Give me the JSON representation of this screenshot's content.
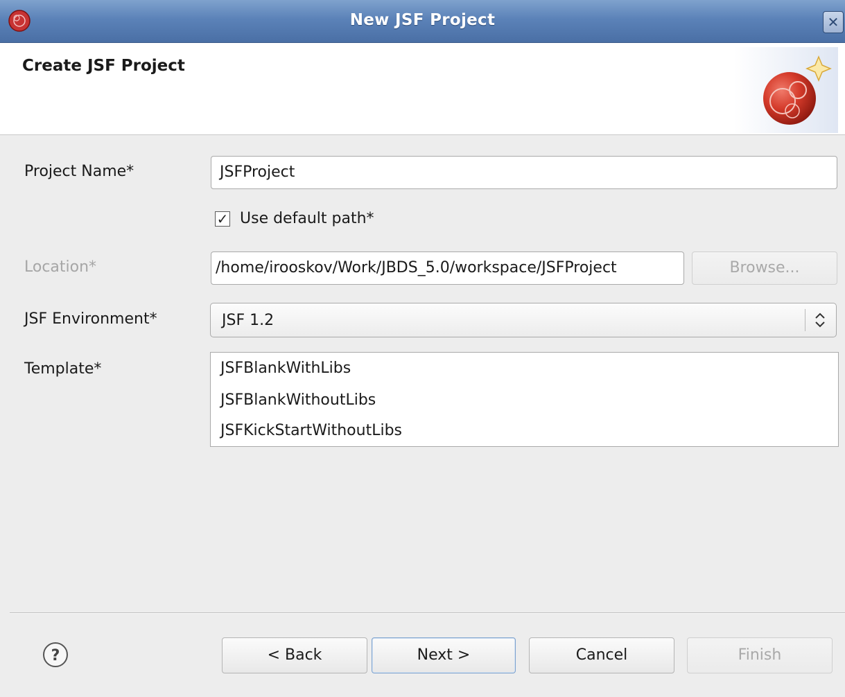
{
  "window": {
    "title": "New JSF Project",
    "close_glyph": "✕"
  },
  "header": {
    "title": "Create JSF Project",
    "banner_icon": "jsf-project-wizard-icon"
  },
  "form": {
    "project_name": {
      "label": "Project Name*",
      "value": "JSFProject"
    },
    "use_default_path": {
      "label": "Use default path*",
      "checked": true
    },
    "location": {
      "label": "Location*",
      "value": "/home/irooskov/Work/JBDS_5.0/workspace/JSFProject",
      "browse_label": "Browse..."
    },
    "jsf_environment": {
      "label": "JSF Environment*",
      "value": "JSF 1.2"
    },
    "template": {
      "label": "Template*",
      "items": [
        "JSFBlankWithLibs",
        "JSFBlankWithoutLibs",
        "JSFKickStartWithoutLibs"
      ]
    }
  },
  "footer": {
    "help_icon": "help-icon",
    "back_label": "< Back",
    "next_label": "Next >",
    "cancel_label": "Cancel",
    "finish_label": "Finish"
  }
}
